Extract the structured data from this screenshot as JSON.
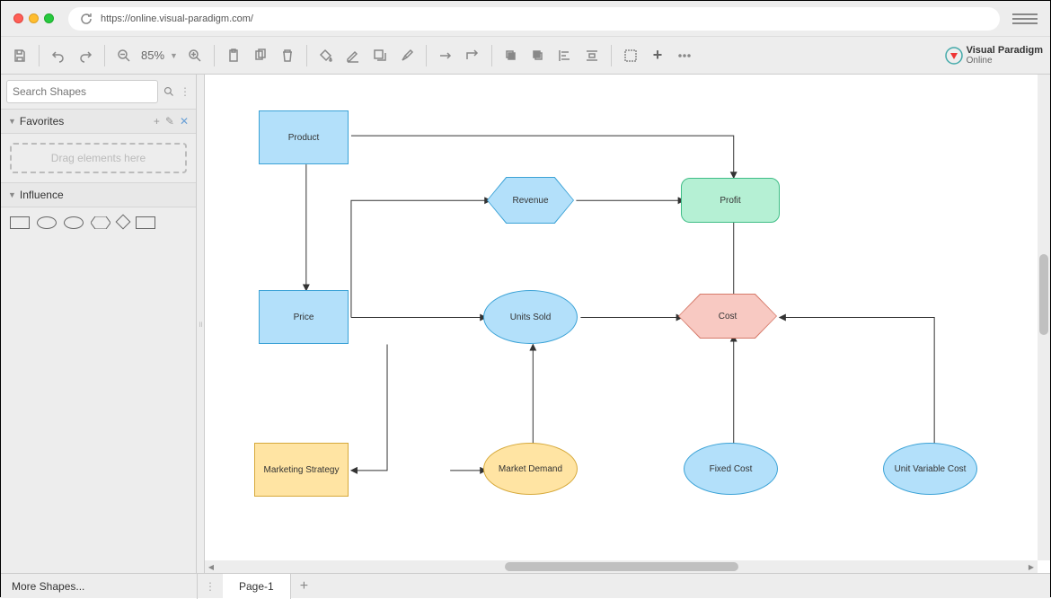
{
  "chrome": {
    "url": "https://online.visual-paradigm.com/"
  },
  "toolbar": {
    "zoom": "85%"
  },
  "brand": {
    "name": "Visual Paradigm",
    "sub": "Online"
  },
  "sidebar": {
    "search_placeholder": "Search Shapes",
    "favorites_label": "Favorites",
    "dropzone": "Drag elements here",
    "influence_label": "Influence"
  },
  "footer": {
    "more": "More Shapes...",
    "page": "Page-1"
  },
  "diagram": {
    "nodes": {
      "product": "Product",
      "price": "Price",
      "revenue": "Revenue",
      "profit": "Profit",
      "units_sold": "Units Sold",
      "cost": "Cost",
      "marketing_strategy": "Marketing Strategy",
      "market_demand": "Market Demand",
      "fixed_cost": "Fixed Cost",
      "unit_variable_cost": "Unit Variable Cost"
    },
    "edges": [
      {
        "from": "product",
        "to": "profit"
      },
      {
        "from": "product",
        "to": "price"
      },
      {
        "from": "price",
        "to": "revenue"
      },
      {
        "from": "revenue",
        "to": "profit"
      },
      {
        "from": "price",
        "to": "units_sold"
      },
      {
        "from": "units_sold",
        "to": "cost"
      },
      {
        "from": "cost",
        "to": "profit"
      },
      {
        "from": "price",
        "to": "marketing_strategy"
      },
      {
        "from": "marketing_strategy",
        "to": "market_demand"
      },
      {
        "from": "market_demand",
        "to": "units_sold"
      },
      {
        "from": "fixed_cost",
        "to": "cost"
      },
      {
        "from": "unit_variable_cost",
        "to": "cost"
      }
    ]
  }
}
